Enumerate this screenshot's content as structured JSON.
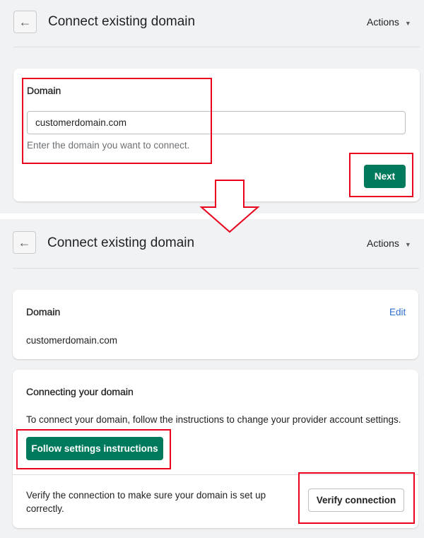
{
  "step1": {
    "header": {
      "title": "Connect existing domain",
      "actions_label": "Actions",
      "back_icon": "arrow-left-icon"
    },
    "domain_card": {
      "label": "Domain",
      "input_value": "customerdomain.com",
      "help_text": "Enter the domain you want to connect.",
      "next_label": "Next"
    }
  },
  "step2": {
    "header": {
      "title": "Connect existing domain",
      "actions_label": "Actions",
      "back_icon": "arrow-left-icon"
    },
    "domain_card": {
      "label": "Domain",
      "edit_label": "Edit",
      "value": "customerdomain.com"
    },
    "connect_card": {
      "heading": "Connecting your domain",
      "text": "To connect your domain, follow the instructions to change your provider account settings.",
      "follow_label": "Follow settings instructions",
      "verify_text": "Verify the connection to make sure your domain is set up correctly.",
      "verify_label": "Verify connection"
    }
  },
  "colors": {
    "primary": "#007a5c",
    "highlight": "#e8001c",
    "link": "#2c6ecb",
    "background": "#f1f2f4"
  }
}
